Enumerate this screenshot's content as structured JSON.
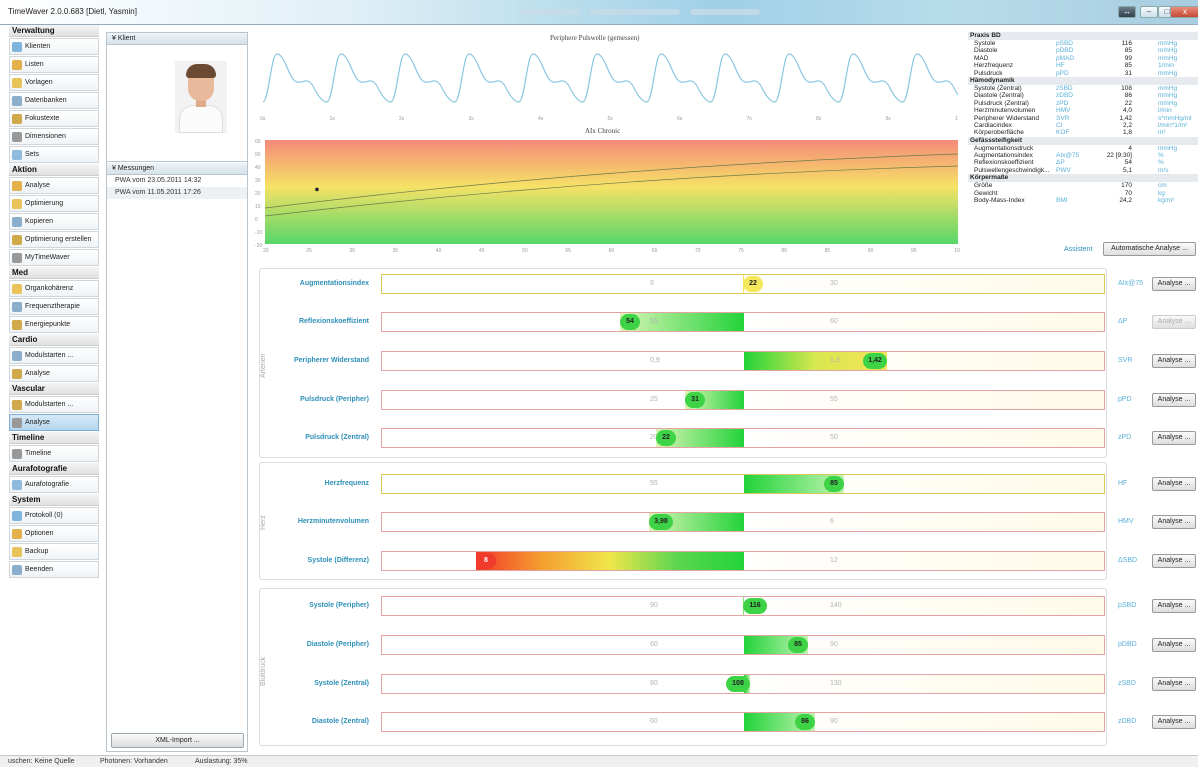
{
  "window": {
    "title": "TimeWaver 2.0.0.683 [Dietl, Yasmin]",
    "buttons": [
      "↔",
      "–",
      "□",
      "x"
    ]
  },
  "sidebar": {
    "sections": [
      {
        "title": "Verwaltung",
        "items": [
          "Klienten",
          "Listen",
          "Vorlagen",
          "Datenbanken",
          "Fokustexte",
          "Dimensionen",
          "Sets"
        ]
      },
      {
        "title": "Aktion",
        "items": [
          "Analyse",
          "Optimierung",
          "Kopieren",
          "Optimierung erstellen",
          "MyTimeWaver"
        ]
      },
      {
        "title": "Med",
        "items": [
          "Organkohärenz",
          "Frequenztherapie",
          "Energiepunkte"
        ]
      },
      {
        "title": "Cardio",
        "items": [
          "Modulstarten ...",
          "Analyse"
        ]
      },
      {
        "title": "Vascular",
        "items": [
          "Modulstarten ...",
          "Analyse"
        ]
      },
      {
        "title": "Timeline",
        "items": [
          "Timeline"
        ]
      },
      {
        "title": "Aurafotografie",
        "items": [
          "Aurafotografie"
        ]
      },
      {
        "title": "System",
        "items": [
          "Protokoll (0)",
          "Optionen",
          "Backup",
          "Beenden"
        ]
      }
    ],
    "selected": "Vascular/Analyse"
  },
  "client_panel": {
    "header": "Klient",
    "messungen_header": "Messungen",
    "messungen": [
      "PWA vom 23.05.2011 14:32",
      "PWA vom 11.05.2011 17:26"
    ],
    "xml_button": "XML-Import ..."
  },
  "pulse_chart": {
    "title": "Periphere Pulswelle (gemessen)",
    "ticks": [
      "0s",
      "1s",
      "2s",
      "3s",
      "4s",
      "5s",
      "6s",
      "7s",
      "8s",
      "9s",
      "10s"
    ]
  },
  "chart_data": {
    "type": "scatter",
    "title": "AIx Chronic",
    "x": [
      26
    ],
    "y": [
      22
    ],
    "xlim": [
      20,
      100
    ],
    "ylim": [
      -20,
      60
    ],
    "xticks": [
      "20",
      "25",
      "30",
      "35",
      "40",
      "45",
      "50",
      "55",
      "60",
      "65",
      "70",
      "75",
      "80",
      "85",
      "90",
      "95",
      "100"
    ],
    "yticks": [
      "60",
      "50",
      "40",
      "30",
      "20",
      "10",
      "0",
      "-10",
      "-20"
    ]
  },
  "info": {
    "groups": [
      {
        "title": "Praxis BD",
        "rows": [
          [
            "Systole",
            "pSBD",
            "116",
            "mmHg"
          ],
          [
            "Diastole",
            "pDBD",
            "85",
            "mmHg"
          ],
          [
            "MAD",
            "pMAD",
            "99",
            "mmHg"
          ],
          [
            "Herzfrequenz",
            "HF",
            "85",
            "1/min"
          ],
          [
            "Pulsdruck",
            "pPD",
            "31",
            "mmHg"
          ]
        ]
      },
      {
        "title": "Hämodynamik",
        "rows": [
          [
            "Systole (Zentral)",
            "zSBD",
            "108",
            "mmHg"
          ],
          [
            "Diastole (Zentral)",
            "zDBD",
            "86",
            "mmHg"
          ],
          [
            "Pulsdruck (Zentral)",
            "zPD",
            "22",
            "mmHg"
          ],
          [
            "Herzminutenvolumen",
            "HMV",
            "4,0",
            "l/min"
          ],
          [
            "Peripherer Widerstand",
            "SVR",
            "1,42",
            "s*mmHg/ml"
          ],
          [
            "Cardiacindex",
            "CI",
            "2,2",
            "l/min*1/m²"
          ],
          [
            "Körperoberfläche",
            "KOF",
            "1,8",
            "m²"
          ]
        ]
      },
      {
        "title": "Gefässsteifigkeit",
        "rows": [
          [
            "Augmentationsdruck",
            "",
            "4",
            "mmHg"
          ],
          [
            "Augmentationsindex",
            "AIx@75",
            "22 [9;30]",
            "%"
          ],
          [
            "Reflexionskoeffizient",
            "ΔP",
            "54",
            "%"
          ],
          [
            "Pulswellengeschwindigk...",
            "PWV",
            "5,1",
            "m/s"
          ]
        ]
      },
      {
        "title": "Körpermaße",
        "rows": [
          [
            "Größe",
            "",
            "170",
            "cm"
          ],
          [
            "Gewicht",
            "",
            "70",
            "kg"
          ],
          [
            "Body-Mass-Index",
            "BMI",
            "24,2",
            "kg/m²"
          ]
        ]
      }
    ],
    "assist": "Assistent",
    "auto_button": "Automatische Analyse ..."
  },
  "metrics": [
    {
      "label": "Augmentationsindex",
      "abbr": "AIx@75",
      "value": "22",
      "fraction": 0.5,
      "t1": "9",
      "t2": "30",
      "button": "Analyse ...",
      "enabled": true,
      "border": "yl",
      "fill": "y"
    },
    {
      "label": "Reflexionskoeffizient",
      "abbr": "ΔP",
      "value": "54",
      "fraction": 0.33,
      "t1": "55",
      "t2": "60",
      "button": "Analyse ...",
      "enabled": false,
      "border": "red",
      "fill": "g"
    },
    {
      "label": "Peripherer Widerstand",
      "abbr": "SVR",
      "value": "1,42",
      "fraction": 0.7,
      "t1": "0,9",
      "t2": "1,3",
      "button": "Analyse ...",
      "enabled": true,
      "border": "red",
      "fill": "gy"
    },
    {
      "label": "Pulsdruck (Peripher)",
      "abbr": "pPD",
      "value": "31",
      "fraction": 0.42,
      "t1": "25",
      "t2": "55",
      "button": "Analyse ...",
      "enabled": true,
      "border": "red",
      "fill": "g"
    },
    {
      "label": "Pulsdruck (Zentral)",
      "abbr": "zPD",
      "value": "22",
      "fraction": 0.38,
      "t1": "20",
      "t2": "50",
      "button": "Analyse ...",
      "enabled": true,
      "border": "red",
      "fill": "g"
    },
    {
      "label": "Herzfrequenz",
      "abbr": "HF",
      "value": "85",
      "fraction": 0.64,
      "t1": "55",
      "t2": "",
      "button": "Analyse ...",
      "enabled": true,
      "border": "yl",
      "fill": "g"
    },
    {
      "label": "Herzminutenvolumen",
      "abbr": "HMV",
      "value": "3,98",
      "fraction": 0.37,
      "t1": "",
      "t2": "6",
      "button": "Analyse ...",
      "enabled": true,
      "border": "red",
      "fill": "g"
    },
    {
      "label": "Systole (Differenz)",
      "abbr": "ΔSBD",
      "value": "8",
      "fraction": 0.13,
      "t1": "",
      "t2": "12",
      "button": "Analyse ...",
      "enabled": true,
      "border": "red",
      "fill": "ryg"
    },
    {
      "label": "Systole (Peripher)",
      "abbr": "pSBD",
      "value": "116",
      "fraction": 0.5,
      "t1": "90",
      "t2": "140",
      "button": "Analyse ...",
      "enabled": true,
      "border": "red",
      "fill": "g"
    },
    {
      "label": "Diastole (Peripher)",
      "abbr": "pDBD",
      "value": "85",
      "fraction": 0.59,
      "t1": "60",
      "t2": "90",
      "button": "Analyse ...",
      "enabled": true,
      "border": "red",
      "fill": "g"
    },
    {
      "label": "Systole (Zentral)",
      "abbr": "zSBD",
      "value": "108",
      "fraction": 0.51,
      "t1": "80",
      "t2": "130",
      "button": "Analyse ...",
      "enabled": true,
      "border": "red",
      "fill": "g"
    },
    {
      "label": "Diastole (Zentral)",
      "abbr": "zDBD",
      "value": "86",
      "fraction": 0.6,
      "t1": "60",
      "t2": "90",
      "button": "Analyse ...",
      "enabled": true,
      "border": "red",
      "fill": "g"
    }
  ],
  "groups": [
    "Arterien",
    "Herz",
    "Blutdruck"
  ],
  "status": {
    "left": "uschen: Keine Quelle",
    "mid": "Photonen: Vorhanden",
    "right": "Auslastung: 35%"
  }
}
